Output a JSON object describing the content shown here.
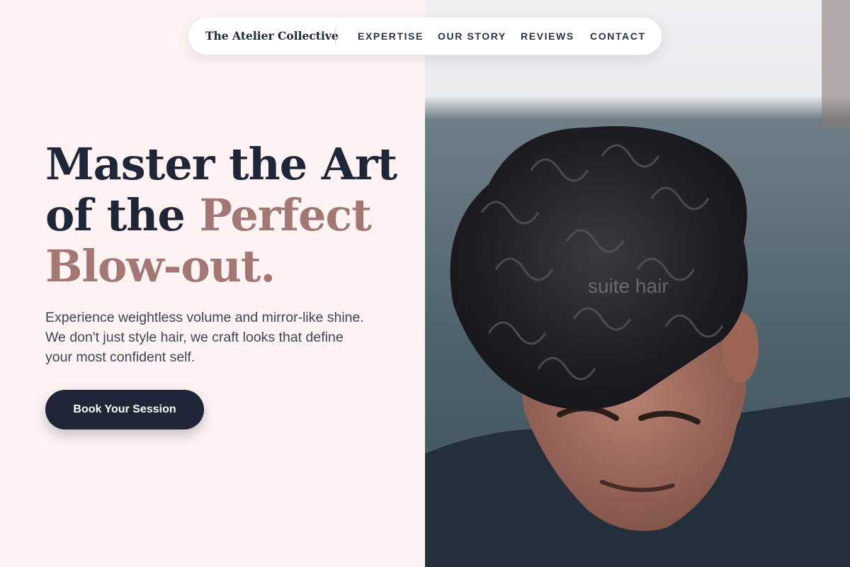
{
  "brand": {
    "name": "The Atelier Collective"
  },
  "nav": {
    "links": [
      "EXPERTISE",
      "OUR STORY",
      "REVIEWS",
      "CONTACT"
    ]
  },
  "hero": {
    "headline_line1": "Master the Art",
    "headline_line2_a": "of the ",
    "headline_line2_b": "Perfect",
    "headline_line3": "Blow-out.",
    "lead": "Experience weightless volume and mirror-like shine. We don't just style hair, we craft looks that define your most confident self.",
    "cta_label": "Book Your Session"
  },
  "photo": {
    "subject": "man-with-curly-dark-hair",
    "watermark": "suite hair"
  },
  "colors": {
    "navy": "#1e2638",
    "accent": "#a37874",
    "background": "#fff4f3"
  }
}
